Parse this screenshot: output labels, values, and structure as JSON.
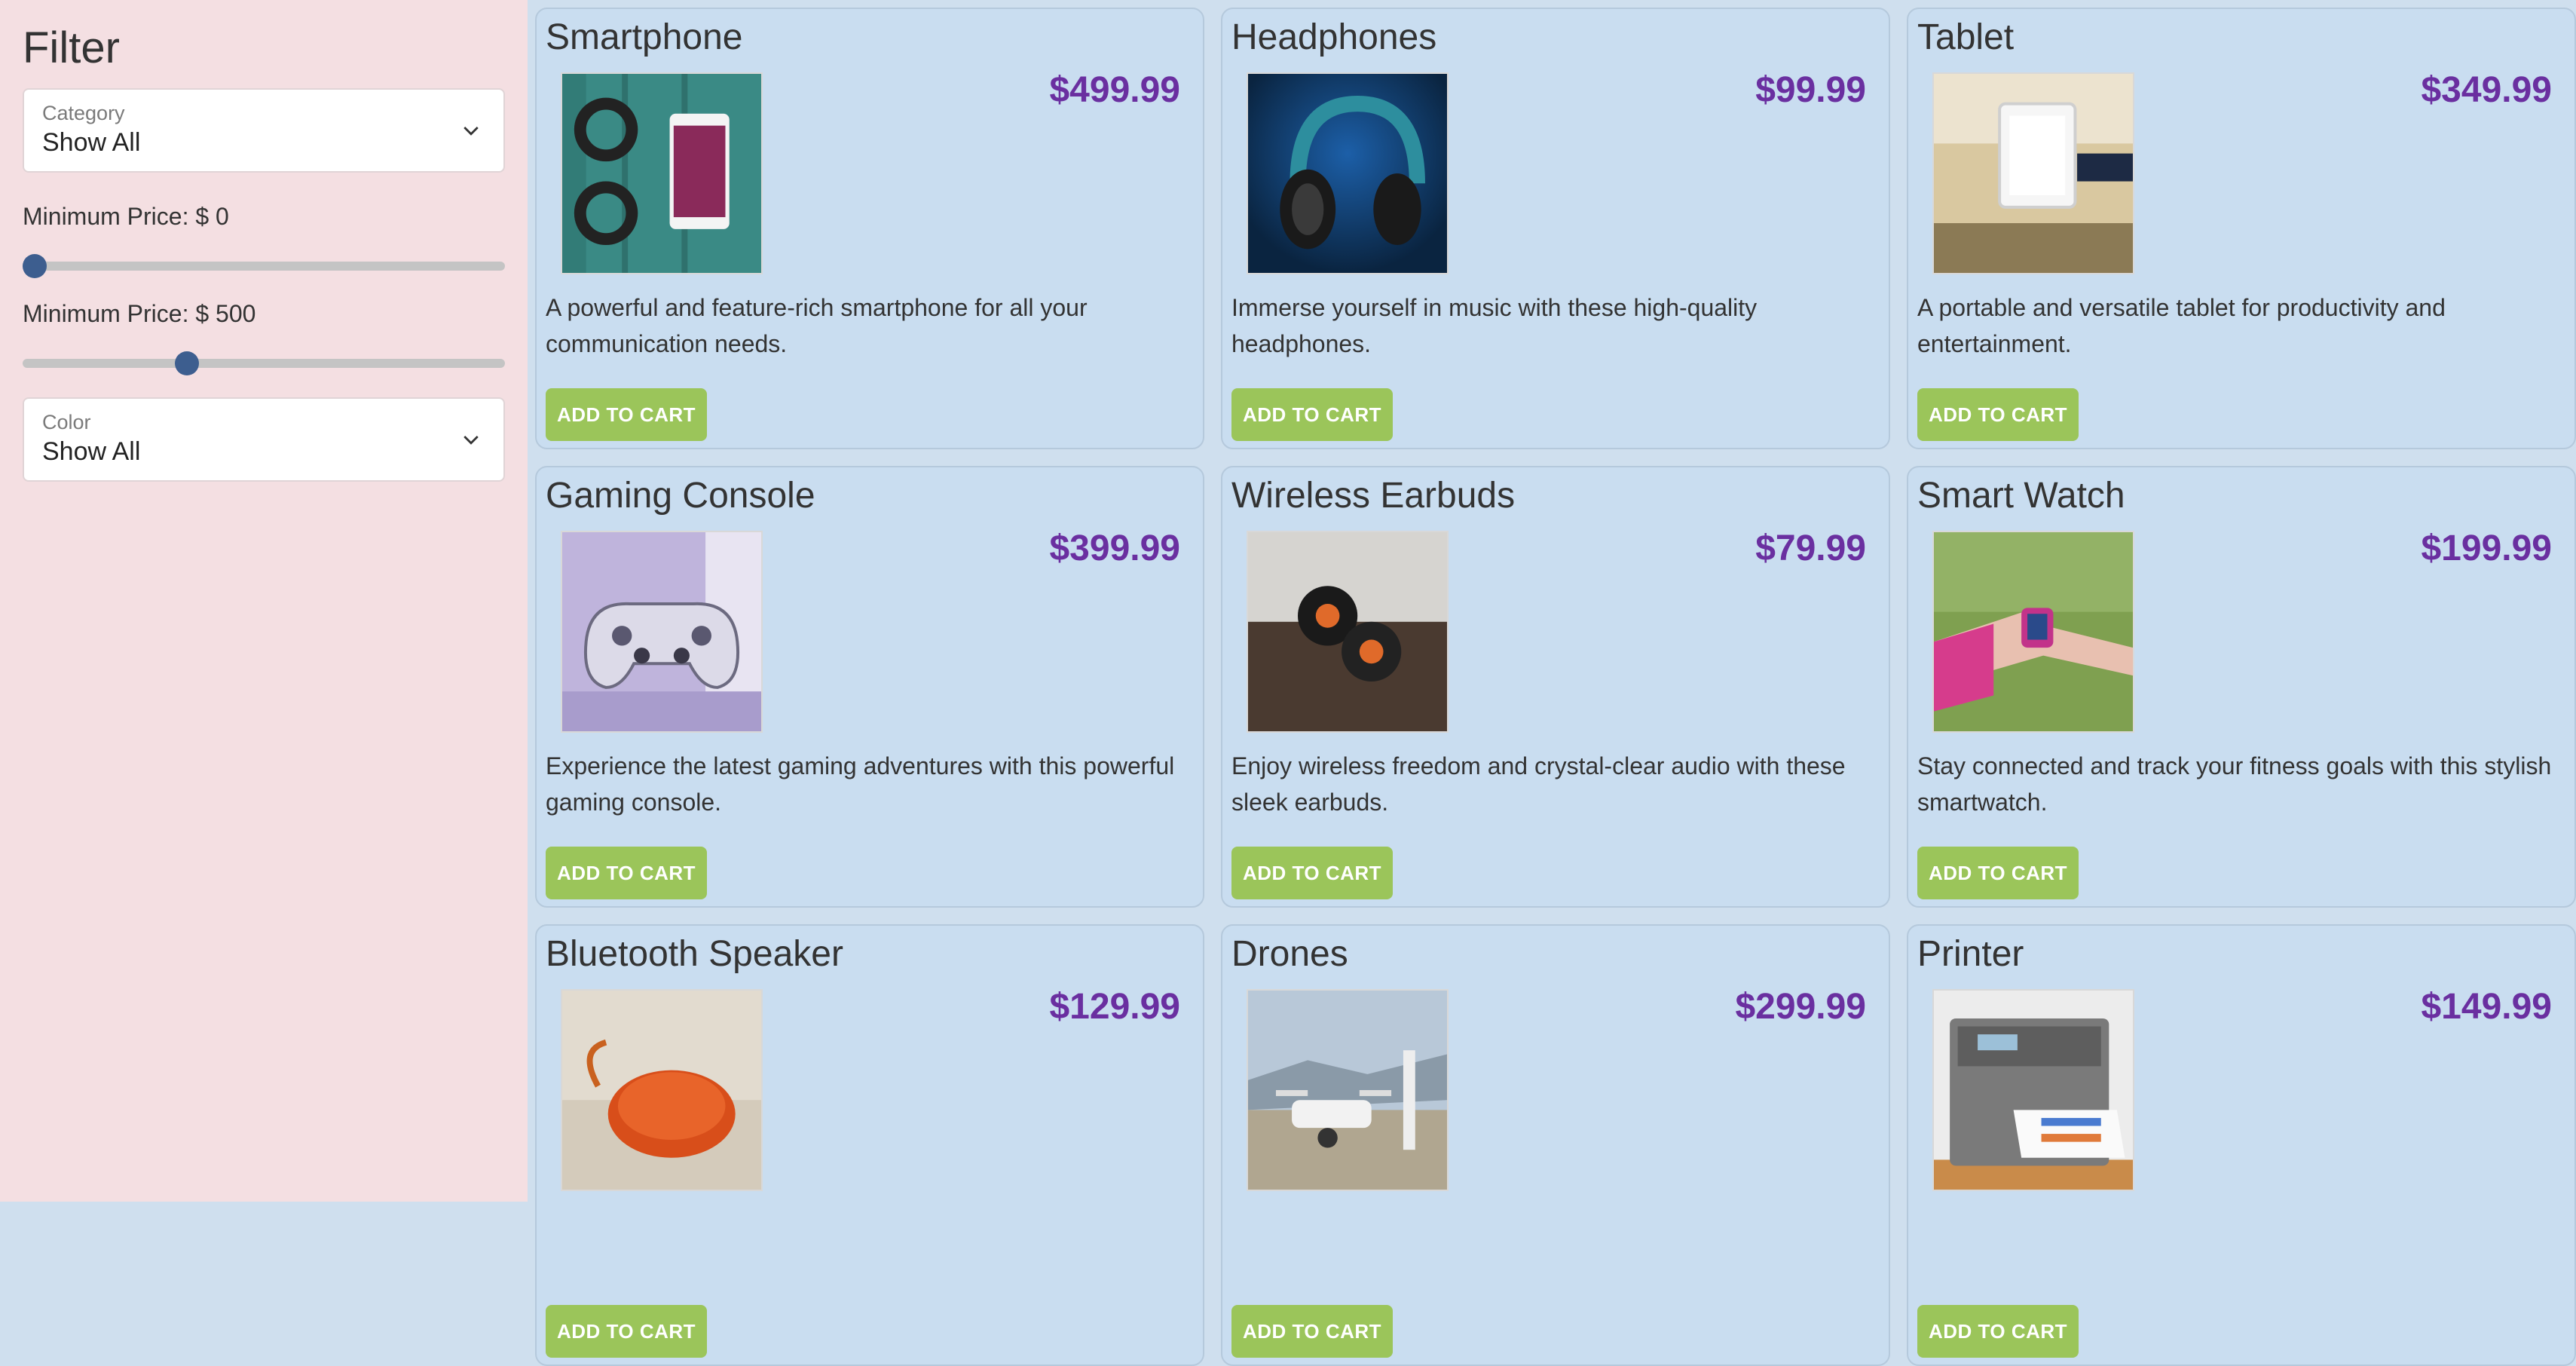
{
  "sidebar": {
    "title": "Filter",
    "category": {
      "label": "Category",
      "value": "Show All"
    },
    "min_price": {
      "label": "Minimum Price: $ 0",
      "value": 0
    },
    "max_price": {
      "label": "Minimum Price: $ 500",
      "value": 500
    },
    "color": {
      "label": "Color",
      "value": "Show All"
    }
  },
  "products": [
    {
      "name": "Smartphone",
      "price": "$499.99",
      "description": "A powerful and feature-rich smartphone for all your communication needs.",
      "button": "ADD TO CART"
    },
    {
      "name": "Headphones",
      "price": "$99.99",
      "description": "Immerse yourself in music with these high-quality headphones.",
      "button": "ADD TO CART"
    },
    {
      "name": "Tablet",
      "price": "$349.99",
      "description": "A portable and versatile tablet for productivity and entertainment.",
      "button": "ADD TO CART"
    },
    {
      "name": "Gaming Console",
      "price": "$399.99",
      "description": "Experience the latest gaming adventures with this powerful gaming console.",
      "button": "ADD TO CART"
    },
    {
      "name": "Wireless Earbuds",
      "price": "$79.99",
      "description": "Enjoy wireless freedom and crystal-clear audio with these sleek earbuds.",
      "button": "ADD TO CART"
    },
    {
      "name": "Smart Watch",
      "price": "$199.99",
      "description": "Stay connected and track your fitness goals with this stylish smartwatch.",
      "button": "ADD TO CART"
    },
    {
      "name": "Bluetooth Speaker",
      "price": "$129.99",
      "description": "",
      "button": "ADD TO CART"
    },
    {
      "name": "Drones",
      "price": "$299.99",
      "description": "",
      "button": "ADD TO CART"
    },
    {
      "name": "Printer",
      "price": "$149.99",
      "description": "",
      "button": "ADD TO CART"
    }
  ],
  "colors": {
    "sidebar_bg": "#f4dfe2",
    "card_bg": "#c9ddf0",
    "price": "#6a2fa0",
    "button": "#9bc55a",
    "slider_thumb": "#3d5e8f"
  }
}
